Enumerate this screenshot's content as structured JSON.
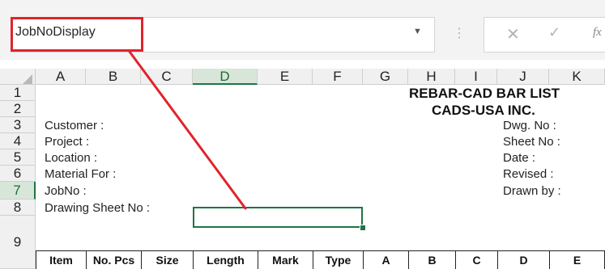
{
  "formula_bar": {
    "name_box": "JobNoDisplay",
    "formula": ""
  },
  "columns": [
    "A",
    "B",
    "C",
    "D",
    "E",
    "F",
    "G",
    "H",
    "I",
    "J",
    "K"
  ],
  "selected_column": "D",
  "rows": [
    "1",
    "2",
    "3",
    "4",
    "5",
    "6",
    "7",
    "8",
    "9"
  ],
  "selected_row": "7",
  "title_line1": "REBAR-CAD BAR LIST",
  "title_line2": "CADS-USA INC.",
  "left_labels": {
    "r3": "Customer :",
    "r4": "Project :",
    "r5": "Location :",
    "r6": "Material For :",
    "r7": "JobNo :",
    "r8": "Drawing Sheet No :"
  },
  "right_labels": {
    "r3": "Dwg. No :",
    "r4": "Sheet No :",
    "r5": "Date :",
    "r6": "Revised :",
    "r7": "Drawn by :"
  },
  "table_headers": [
    "Item",
    "No. Pcs",
    "Size",
    "Length",
    "Mark",
    "Type",
    "A",
    "B",
    "C",
    "D",
    "E"
  ],
  "colors": {
    "accent_green": "#217346",
    "annotation_red": "#e0242c"
  }
}
